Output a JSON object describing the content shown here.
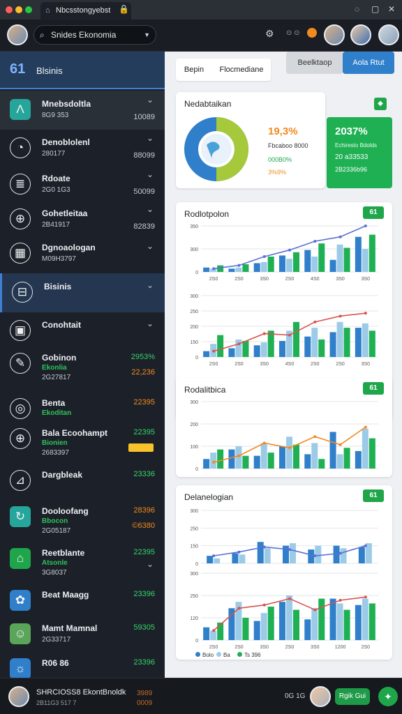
{
  "browser": {
    "tab_title": "Nbcsstongyebst",
    "tab_close": "×"
  },
  "topbar": {
    "search_value": "Snides Ekonomia"
  },
  "sidebar": {
    "header": {
      "logo": "61",
      "title": "Blsinis"
    },
    "items": [
      {
        "title": "Mnebsdoltla",
        "sub": "8G9 353",
        "value": "10089",
        "icon": "Λ",
        "icon_name": "chart-peak-icon"
      },
      {
        "title": "Denoblolenl",
        "sub": "280177",
        "value": "88099",
        "icon": "◔",
        "icon_name": "dial-icon"
      },
      {
        "title": "Rdoate",
        "sub": "2G0 1G3",
        "value": "50099",
        "icon": "≣",
        "icon_name": "document-list-icon"
      },
      {
        "title": "Gohetleitaa",
        "sub": "2B41917",
        "value": "82839",
        "icon": "⊕",
        "icon_name": "globe-icon"
      },
      {
        "title": "Dgnoaologan",
        "sub": "M09H3797",
        "value": "",
        "icon": "▦",
        "icon_name": "grid-icon"
      },
      {
        "title": "Bisinis",
        "sub": "",
        "value": "",
        "icon": "⊟",
        "icon_name": "building-icon"
      },
      {
        "title": "Conohtait",
        "sub": "",
        "value": "",
        "icon": "▣",
        "icon_name": "calendar-icon"
      },
      {
        "title": "Gobinon",
        "sub2": "Ekonlia",
        "sub": "2G27817",
        "value": "2953%",
        "value2": "22,236",
        "icon": "✎",
        "icon_name": "tools-icon"
      },
      {
        "title": "Benta",
        "sub2": "Ekoditan",
        "sub": "",
        "value": "22395",
        "icon": "◎",
        "icon_name": "target-icon"
      },
      {
        "title": "Bala Ecoohampt",
        "sub2": "Bionien",
        "sub": "2683397",
        "value": "22395",
        "icon": "⊕",
        "icon_name": "leaf-globe-icon"
      },
      {
        "title": "Dargbleak",
        "sub": "",
        "value": "23336",
        "icon": "⊿",
        "icon_name": "ramp-icon"
      },
      {
        "title": "Dooloofang",
        "sub2": "Bbocon",
        "sub": "2G05187",
        "value": "28396",
        "value2": "©6380",
        "icon": "↻",
        "icon_name": "recycle-icon"
      },
      {
        "title": "Reetblante",
        "sub2": "Atsonle",
        "sub": "3G8037",
        "value": "22395",
        "icon": "⌂",
        "icon_name": "home-leaf-icon"
      },
      {
        "title": "Beat Maagg",
        "sub": "",
        "value": "23396",
        "icon": "✿",
        "icon_name": "tree-icon"
      },
      {
        "title": "Mamt Mamnal",
        "sub": "2G33717",
        "value": "59305",
        "icon": "☺",
        "icon_name": "person-icon"
      },
      {
        "title": "R06 86",
        "sub": "",
        "value": "23396",
        "icon": "☼",
        "icon_name": "gear-eco-icon"
      }
    ]
  },
  "toolbar": {
    "tab1": "Bepin",
    "tab2": "Flocmediane",
    "btn1": "Beelktaop",
    "btn2": "Aola Rtut"
  },
  "overview": {
    "title": "Nedabtaikan",
    "pct1": "19,3%",
    "line1": "Fbcaboo 8000",
    "line2": "000B0%",
    "line3": "3%9%",
    "green_big": "2037%",
    "green_l1": "Echiresto Bdolds",
    "green_l2": "20 a33533",
    "green_l3": "2B2336b96",
    "ring": {
      "blue": 0.48,
      "green": 0.52
    }
  },
  "charts": [
    {
      "title": "Rodlotpolon",
      "badge": "61"
    },
    {
      "title": "Rodalitbica",
      "badge": "61"
    },
    {
      "title": "Delanelogian",
      "badge": "61"
    }
  ],
  "chart_data": [
    {
      "type": "bar",
      "title": "Rodlotpolon",
      "categories": [
        "2S0",
        "2S0",
        "3S0",
        "2S0",
        "4S0",
        "3S0",
        "3S0"
      ],
      "ylim": [
        0,
        300
      ],
      "yticks": [
        "0",
        "300",
        "350"
      ],
      "series": [
        {
          "values": [
            40,
            30,
            80,
            150,
            200,
            110,
            320
          ]
        },
        {
          "values": [
            30,
            40,
            90,
            120,
            140,
            250,
            210
          ]
        },
        {
          "values": [
            60,
            70,
            140,
            180,
            260,
            220,
            340
          ]
        }
      ],
      "line": [
        30,
        60,
        140,
        200,
        280,
        320,
        420
      ]
    },
    {
      "type": "bar",
      "title": "Rodlotpolon",
      "categories": [
        "2S0",
        "2S0",
        "3S0",
        "4S0",
        "2S0",
        "2S0",
        "3S0"
      ],
      "ylim": [
        0,
        300
      ],
      "yticks": [
        "0",
        "150",
        "200",
        "250",
        "300"
      ],
      "series": [
        {
          "values": [
            40,
            60,
            80,
            110,
            140,
            170,
            200
          ]
        },
        {
          "values": [
            90,
            120,
            100,
            180,
            200,
            240,
            230
          ]
        },
        {
          "values": [
            150,
            110,
            180,
            240,
            120,
            200,
            180
          ]
        }
      ],
      "line": [
        40,
        90,
        160,
        150,
        240,
        280,
        300
      ]
    },
    {
      "type": "bar",
      "title": "Rodalitbica",
      "categories": [],
      "ylim": [
        0,
        300
      ],
      "yticks": [
        "0",
        "100",
        "200",
        "300"
      ],
      "series": [
        {
          "values": [
            60,
            120,
            80,
            140,
            90,
            230,
            110
          ]
        },
        {
          "values": [
            100,
            140,
            160,
            200,
            160,
            90,
            250
          ]
        },
        {
          "values": [
            120,
            80,
            100,
            150,
            60,
            130,
            190
          ]
        }
      ],
      "line": [
        40,
        80,
        160,
        130,
        200,
        150,
        260
      ]
    },
    {
      "type": "bar",
      "title": "Delanelogian",
      "categories": [],
      "ylim": [
        0,
        300
      ],
      "yticks": [
        "0",
        "150",
        "250",
        "300"
      ],
      "series": [
        {
          "values": [
            60,
            80,
            170,
            140,
            110,
            140,
            130
          ]
        },
        {
          "values": [
            40,
            70,
            120,
            160,
            140,
            120,
            160
          ]
        }
      ],
      "line": [
        60,
        90,
        130,
        110,
        60,
        80,
        140
      ]
    },
    {
      "type": "bar",
      "title": "Delanelogian",
      "categories": [
        "2S0",
        "2S0",
        "3S0",
        "2S0",
        "3S0",
        "1200",
        "2S0"
      ],
      "ylim": [
        0,
        300
      ],
      "yticks": [
        "0",
        "120",
        "250",
        "300"
      ],
      "series": [
        {
          "values": [
            80,
            200,
            120,
            240,
            130,
            260,
            220
          ]
        },
        {
          "values": [
            60,
            240,
            170,
            280,
            200,
            230,
            260
          ]
        },
        {
          "values": [
            110,
            140,
            210,
            190,
            260,
            190,
            230
          ]
        }
      ],
      "line": [
        60,
        200,
        220,
        260,
        190,
        250,
        270
      ],
      "legend": [
        "Bolo",
        "Ba",
        "Ts 396"
      ]
    }
  ],
  "bottom": {
    "user": "SHRCIOSS8 EkontBnoldk",
    "user_sub": "2B11G3 517 7",
    "right_text": "0G 1G",
    "btn": "Rgik Gui",
    "val1": "3989",
    "val2": "0009"
  },
  "colors": {
    "accent": "#3f7fd1",
    "green": "#1fa54a",
    "orange": "#f28a1e",
    "blue": "#2f7fca",
    "lightblue": "#9ccbe8",
    "lime": "#8dc63f"
  }
}
